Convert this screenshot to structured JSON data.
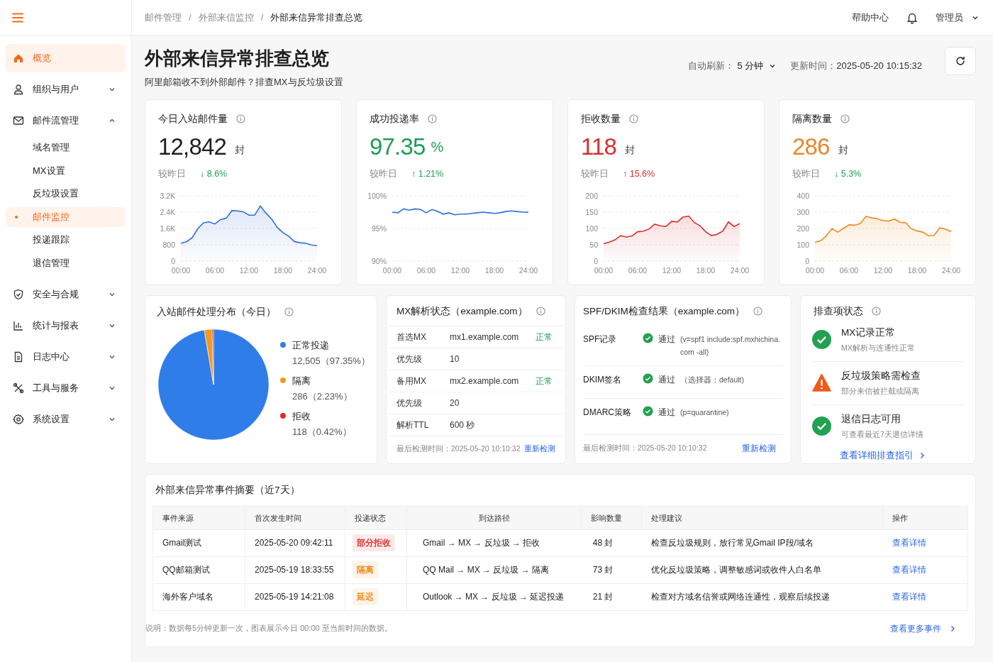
{
  "breadcrumb": {
    "separator": "/",
    "items": [
      {
        "label": "邮件管理",
        "current": false
      },
      {
        "label": "外部来信监控",
        "current": false
      },
      {
        "label": "外部来信异常排查总览",
        "current": true
      }
    ]
  },
  "header": {
    "help": "帮助中心",
    "user": "管理员"
  },
  "sidebar": {
    "items": [
      {
        "kind": "link",
        "label": "概览",
        "selected": true
      },
      {
        "kind": "group",
        "label": "组织与用户",
        "expanded": false,
        "selected": false
      },
      {
        "kind": "group",
        "label": "邮件流管理",
        "expanded": true,
        "selected": false,
        "children": [
          {
            "label": "域名管理",
            "selected": false
          },
          {
            "label": "MX设置",
            "selected": false
          },
          {
            "label": "反垃圾设置",
            "selected": false
          },
          {
            "label": "邮件监控",
            "selected": true
          },
          {
            "label": "投递跟踪",
            "selected": false
          },
          {
            "label": "退信管理",
            "selected": false
          }
        ]
      },
      {
        "kind": "group",
        "label": "安全与合规",
        "expanded": false,
        "selected": false
      },
      {
        "kind": "group",
        "label": "统计与报表",
        "expanded": false,
        "selected": false
      },
      {
        "kind": "group",
        "label": "日志中心",
        "expanded": false,
        "selected": false
      },
      {
        "kind": "group",
        "label": "工具与服务",
        "expanded": false,
        "selected": false
      },
      {
        "kind": "group",
        "label": "系统设置",
        "expanded": false,
        "selected": false
      }
    ]
  },
  "page": {
    "title": "外部来信异常排查总览",
    "subtitle": "阿里邮箱收不到外部邮件？排查MX与反垃圾设置",
    "auto_refresh_label": "自动刷新：",
    "auto_refresh_value": "5 分钟",
    "updated_label": "更新时间：",
    "updated_value": "2025-05-20 10:15:32"
  },
  "stats": [
    {
      "title": "今日入站邮件量",
      "value": "12,842",
      "unit": "封",
      "color": "#1f1f1f",
      "compare_label": "较昨日",
      "change": {
        "text": "↓ 8.6%",
        "color": "#1f9d55"
      },
      "chart_data": {
        "type": "area",
        "grid": true,
        "xlim": [
          0,
          24
        ],
        "x": [
          0,
          1,
          2,
          3,
          4,
          5,
          6,
          7,
          8,
          9,
          10,
          11,
          12,
          13,
          14,
          15,
          16,
          17,
          18,
          19,
          20,
          21,
          22,
          23,
          24
        ],
        "xticks": [
          {
            "value": 0,
            "label": "00:00"
          },
          {
            "value": 6,
            "label": "06:00"
          },
          {
            "value": 12,
            "label": "12:00"
          },
          {
            "value": 18,
            "label": "18:00"
          },
          {
            "value": 24,
            "label": "24:00"
          }
        ],
        "ylim": [
          0,
          3200
        ],
        "yticks": [
          0,
          {
            "value": 800,
            "label": "800"
          },
          {
            "value": 1600,
            "label": "1.6K"
          },
          {
            "value": 2400,
            "label": "2.4K"
          },
          {
            "value": 3200,
            "label": "3.2K"
          }
        ],
        "series": [
          {
            "color": "#2f6fdb",
            "values": [
              880,
              950,
              1150,
              1600,
              1880,
              1920,
              1820,
              2040,
              2100,
              2480,
              2460,
              2420,
              2250,
              2250,
              2700,
              2350,
              2060,
              1650,
              1400,
              1220,
              960,
              900,
              880,
              790,
              760
            ]
          }
        ]
      }
    },
    {
      "title": "成功投递率",
      "value": "97.35",
      "unit": "%",
      "color": "#1f9d55",
      "compare_label": "较昨日",
      "change": {
        "text": "↑ 1.21%",
        "color": "#1f9d55"
      },
      "chart_data": {
        "type": "line",
        "grid": true,
        "xlim": [
          0,
          24
        ],
        "x": [
          0,
          1,
          2,
          3,
          4,
          5,
          6,
          7,
          8,
          9,
          10,
          11,
          12,
          13,
          14,
          15,
          16,
          17,
          18,
          19,
          20,
          21,
          22,
          23,
          24
        ],
        "xticks": [
          {
            "value": 0,
            "label": "00:00"
          },
          {
            "value": 6,
            "label": "06:00"
          },
          {
            "value": 12,
            "label": "12:00"
          },
          {
            "value": 18,
            "label": "18:00"
          },
          {
            "value": 24,
            "label": "24:00"
          }
        ],
        "ylim": [
          90,
          100
        ],
        "yticks": [
          {
            "value": 90,
            "label": "90%"
          },
          {
            "value": 95,
            "label": "95%"
          },
          {
            "value": 100,
            "label": "100%"
          }
        ],
        "series": [
          {
            "color": "#2f6fdb",
            "values": [
              97.5,
              97.4,
              98.0,
              97.8,
              98.0,
              97.9,
              97.4,
              97.9,
              97.6,
              97.2,
              97.4,
              97.1,
              97.2,
              97.2,
              97.3,
              97.4,
              97.5,
              97.4,
              97.3,
              97.4,
              97.6,
              97.7,
              97.6,
              97.5,
              97.5
            ]
          }
        ]
      }
    },
    {
      "title": "拒收数量",
      "value": "118",
      "unit": "封",
      "color": "#d92d2d",
      "compare_label": "较昨日",
      "change": {
        "text": "↑ 15.6%",
        "color": "#d92d2d"
      },
      "chart_data": {
        "type": "area",
        "grid": true,
        "xlim": [
          0,
          24
        ],
        "x": [
          0,
          1,
          2,
          3,
          4,
          5,
          6,
          7,
          8,
          9,
          10,
          11,
          12,
          13,
          14,
          15,
          16,
          17,
          18,
          19,
          20,
          21,
          22,
          23,
          24
        ],
        "xticks": [
          {
            "value": 0,
            "label": "00:00"
          },
          {
            "value": 6,
            "label": "06:00"
          },
          {
            "value": 12,
            "label": "12:00"
          },
          {
            "value": 18,
            "label": "18:00"
          },
          {
            "value": 24,
            "label": "24:00"
          }
        ],
        "ylim": [
          0,
          200
        ],
        "yticks": [
          0,
          50,
          100,
          150,
          200
        ],
        "series": [
          {
            "color": "#d92d2d",
            "values": [
              53,
              58,
              65,
              78,
              74,
              77,
              90,
              92,
              98,
              113,
              108,
              106,
              122,
              120,
              135,
              138,
              118,
              108,
              90,
              78,
              82,
              92,
              120,
              106,
              115
            ]
          }
        ]
      }
    },
    {
      "title": "隔离数量",
      "value": "286",
      "unit": "封",
      "color": "#e8872a",
      "compare_label": "较昨日",
      "change": {
        "text": "↓ 5.3%",
        "color": "#1f9d55"
      },
      "chart_data": {
        "type": "area",
        "grid": true,
        "xlim": [
          0,
          24
        ],
        "x": [
          0,
          1,
          2,
          3,
          4,
          5,
          6,
          7,
          8,
          9,
          10,
          11,
          12,
          13,
          14,
          15,
          16,
          17,
          18,
          19,
          20,
          21,
          22,
          23,
          24
        ],
        "xticks": [
          {
            "value": 0,
            "label": "00:00"
          },
          {
            "value": 6,
            "label": "06:00"
          },
          {
            "value": 12,
            "label": "12:00"
          },
          {
            "value": 18,
            "label": "18:00"
          },
          {
            "value": 24,
            "label": "24:00"
          }
        ],
        "ylim": [
          0,
          400
        ],
        "yticks": [
          0,
          100,
          200,
          300,
          400
        ],
        "series": [
          {
            "color": "#ee8a1e",
            "values": [
              115,
              125,
              155,
              200,
              178,
              200,
              222,
              220,
              230,
              275,
              265,
              260,
              248,
              245,
              258,
              238,
              235,
              198,
              185,
              178,
              155,
              158,
              205,
              195,
              180
            ]
          }
        ]
      }
    }
  ],
  "distribution": {
    "title": "入站邮件处理分布（今日）",
    "chart_data": {
      "type": "pie",
      "categories": [
        "正常投递",
        "隔离",
        "拒收"
      ],
      "values": [
        97.35,
        2.23,
        0.42
      ]
    },
    "legend": [
      {
        "detail": "12,505（97.35%）",
        "color": "#2f7de8"
      },
      {
        "detail": "286（2.23%）",
        "color": "#f29a1f"
      },
      {
        "detail": "118（0.42%）",
        "color": "#e02c2c"
      }
    ]
  },
  "mx": {
    "title": "MX解析状态（example.com）",
    "rows": [
      {
        "label": "首选MX",
        "value": "mx1.example.com",
        "status": "正常"
      },
      {
        "label": "优先级",
        "value": "10"
      },
      {
        "label": "备用MX",
        "value": "mx2.example.com",
        "status": "正常"
      },
      {
        "label": "优先级",
        "value": "20"
      },
      {
        "label": "解析TTL",
        "value": "600 秒"
      }
    ],
    "checked": "最后检测时间：2025-05-20 10:10:32",
    "action": "重新检测"
  },
  "auth": {
    "title": "SPF/DKIM检查结果（example.com）",
    "rows": [
      {
        "label": "SPF记录",
        "result": "通过",
        "detail": "(v=spf1 include:spf.mxhichina.com -all)"
      },
      {
        "label": "DKIM签名",
        "result": "通过",
        "detail": "（选择器：default)"
      },
      {
        "label": "DMARC策略",
        "result": "通过",
        "detail": "(p=quarantine)"
      }
    ],
    "checked": "最后检测时间：2025-05-20 10:10:32",
    "action": "重新检测"
  },
  "checklist": {
    "title": "排查项状态",
    "items": [
      {
        "kind": "ok",
        "title": "MX记录正常",
        "desc": "MX解析与连通性正常"
      },
      {
        "kind": "warn",
        "title": "反垃圾策略需检查",
        "desc": "部分来信被拦截或隔离"
      },
      {
        "kind": "ok",
        "title": "退信日志可用",
        "desc": "可查看最近7天退信详情"
      }
    ],
    "link": "查看详细排查指引"
  },
  "events": {
    "title": "外部来信异常事件摘要（近7天）",
    "columns": [
      "事件来源",
      "首次发生时间",
      "投递状态",
      "到达路径",
      "影响数量",
      "处理建议",
      "操作"
    ],
    "rows": [
      {
        "source": "Gmail测试",
        "time": "2025-05-20 09:42:11",
        "status": "部分拒收",
        "color": "#e03131",
        "path": "Gmail → MX → 反垃圾 → 拒收",
        "count": "48 封",
        "advice": "检查反垃圾规则，放行常见Gmail IP段/域名",
        "action": "查看详情"
      },
      {
        "source": "QQ邮箱测试",
        "time": "2025-05-19 18:33:55",
        "status": "隔离",
        "color": "#f08c1e",
        "path": "QQ Mail → MX → 反垃圾 → 隔离",
        "count": "73 封",
        "advice": "优化反垃圾策略，调整敏感词或收件人白名单",
        "action": "查看详情"
      },
      {
        "source": "海外客户域名",
        "time": "2025-05-19 14:21:08",
        "status": "延迟",
        "color": "#f08c1e",
        "path": "Outlook → MX → 反垃圾 → 延迟投递",
        "count": "21 封",
        "advice": "检查对方域名信誉或网络连通性，观察后续投递",
        "action": "查看详情"
      }
    ],
    "note": "说明：数据每5分钟更新一次，图表展示今日 00:00 至当前时间的数据。",
    "more": "查看更多事件"
  }
}
